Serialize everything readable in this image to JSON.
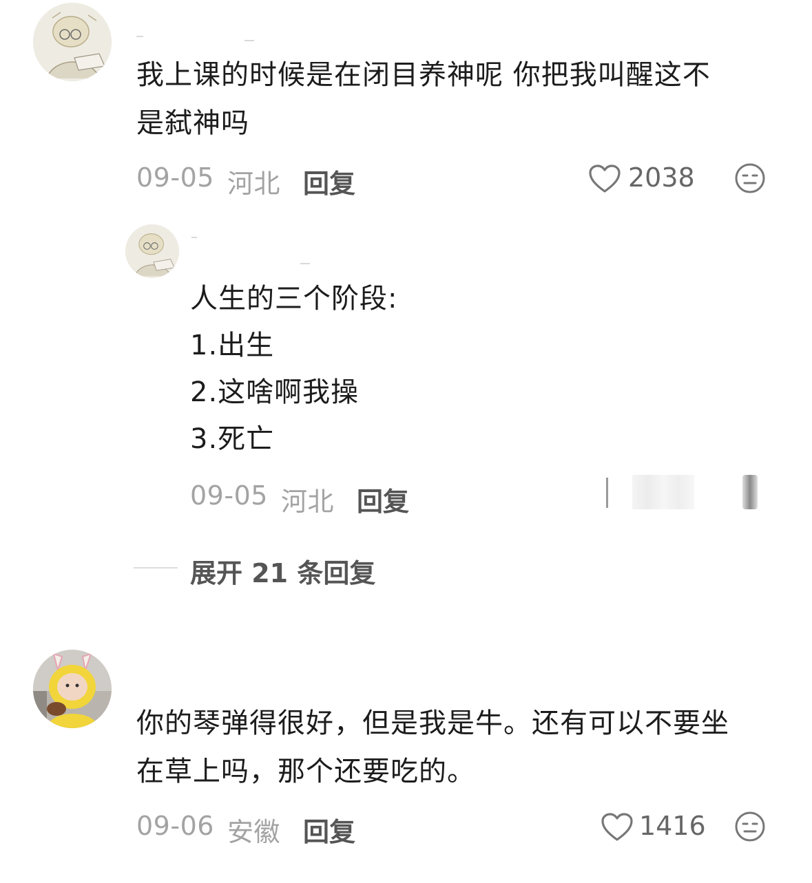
{
  "comments": [
    {
      "text_lines": [
        "我上课的时候是在闭目养神呢 你把我叫醒这不",
        "是弑神吗"
      ],
      "date": "09-05",
      "location": "河北",
      "reply_label": "回复",
      "likes": "2038",
      "avatar_icon": "avatar-sketch-icon",
      "replies": [
        {
          "text_lines": [
            "人生的三个阶段:",
            "1.出生",
            "2.这啥啊我操",
            "3.死亡"
          ],
          "date": "09-05",
          "location": "河北",
          "reply_label": "回复",
          "avatar_icon": "avatar-sketch-icon"
        }
      ],
      "expand_label": "展开 21 条回复"
    },
    {
      "text_lines": [
        "你的琴弹得很好，但是我是牛。还有可以不要坐",
        "在草上吗，那个还要吃的。"
      ],
      "date": "09-06",
      "location": "安徽",
      "reply_label": "回复",
      "likes": "1416",
      "avatar_icon": "avatar-teletubby-icon"
    }
  ],
  "icons": {
    "like": "heart-outline-icon",
    "emoji": "neutral-face-icon"
  },
  "colors": {
    "text": "#1c1c1c",
    "meta": "#a3a3a3",
    "reply": "#555555"
  }
}
